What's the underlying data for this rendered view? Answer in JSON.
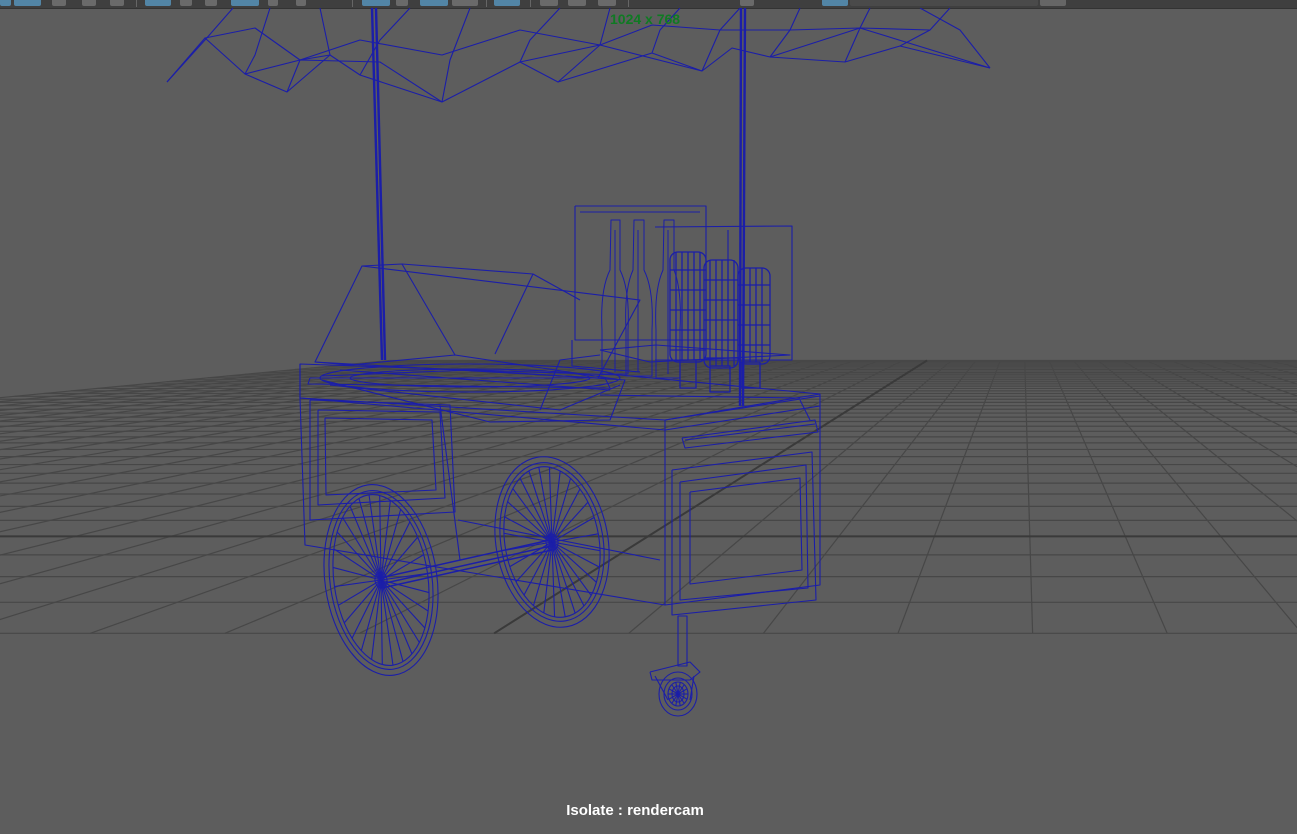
{
  "viewport": {
    "resolution_gate_label": "1024 x 768",
    "isolate_label": "Isolate : rendercam",
    "wireframe_color": "#1b1ea8",
    "grid_color": "#434343",
    "background_color": "#5d5d5d"
  },
  "toolbar": {
    "active_color": "#5285a6",
    "buttons": [
      {
        "name": "panel-layout-icon",
        "state": "active"
      },
      {
        "name": "camera-attributes-icon",
        "state": "active"
      },
      {
        "name": "grid-toggle-icon",
        "state": "active"
      },
      {
        "name": "wireframe-shading-icon",
        "state": "active"
      },
      {
        "name": "isolate-select-icon",
        "state": "active"
      },
      {
        "name": "resolution-gate-icon",
        "state": "active"
      }
    ]
  }
}
